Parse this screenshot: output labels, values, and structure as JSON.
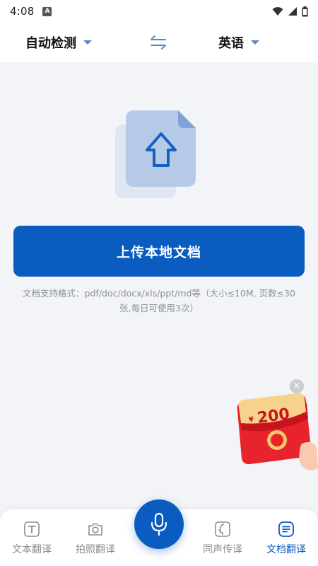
{
  "status_bar": {
    "time": "4:08",
    "notif_letter": "A"
  },
  "lang_bar": {
    "source_lang": "自动检测",
    "target_lang": "英语",
    "swap_icon": "swap-arrows-icon",
    "accent": "#5b86c9"
  },
  "main": {
    "upload_button": "上传本地文档",
    "support_text": "文档支持格式：pdf/doc/docx/xls/ppt/md等（大小≤10M, 页数≤30张,每日可使用3次）",
    "primary_color": "#0b5cc0"
  },
  "promo": {
    "currency": "¥",
    "amount": "200",
    "close": "×"
  },
  "bottom_nav": {
    "items": [
      {
        "label": "文本翻译",
        "icon": "text-t-icon"
      },
      {
        "label": "拍照翻译",
        "icon": "camera-icon"
      },
      {
        "label": "同声传译",
        "icon": "face-profile-icon"
      },
      {
        "label": "文档翻译",
        "icon": "document-icon"
      }
    ],
    "active": "文档翻译",
    "mic_icon": "microphone-icon"
  }
}
